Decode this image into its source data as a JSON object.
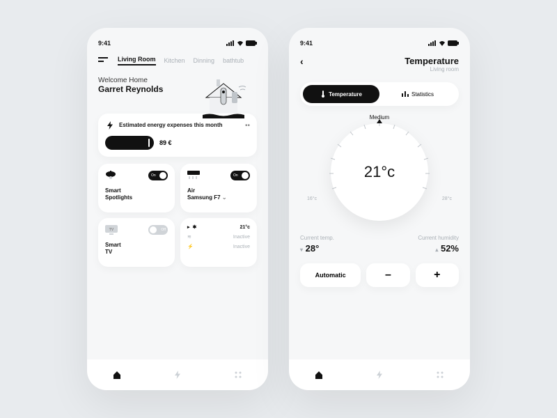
{
  "statusbar": {
    "time": "9:41"
  },
  "phone1": {
    "tabs": [
      "Living Room",
      "Kitchen",
      "Dinning",
      "bathtub"
    ],
    "welcome_line": "Welcome Home",
    "user_name": "Garret Reynolds",
    "energy": {
      "desc": "Estimated energy expenses this month",
      "value": "89 €"
    },
    "devices": {
      "spot": {
        "label_l1": "Smart",
        "label_l2": "Spotlights",
        "toggle": "On"
      },
      "ac": {
        "label_l1": "Air",
        "label_l2": "Samsung F7",
        "toggle": "On"
      },
      "tv": {
        "label_l1": "Smart",
        "label_l2": "TV",
        "toggle": "Off"
      }
    },
    "ac_modes": {
      "cool": {
        "icon": "snow",
        "value": "21°c",
        "active": true
      },
      "fan": {
        "label": "Inactive",
        "active": false
      },
      "power": {
        "label": "Inactive",
        "active": false
      }
    }
  },
  "phone2": {
    "title": "Temperature",
    "subtitle": "Living room",
    "seg": {
      "temp": "Temperature",
      "stats": "Statistics"
    },
    "dial": {
      "mode_label": "Medium",
      "value": "21°c",
      "low": "16°c",
      "high": "28°c"
    },
    "current": {
      "temp_label": "Current temp.",
      "temp_value": "28°",
      "hum_label": "Current humidity",
      "hum_value": "52%"
    },
    "controls": {
      "auto": "Automatic",
      "minus": "–",
      "plus": "+"
    }
  }
}
